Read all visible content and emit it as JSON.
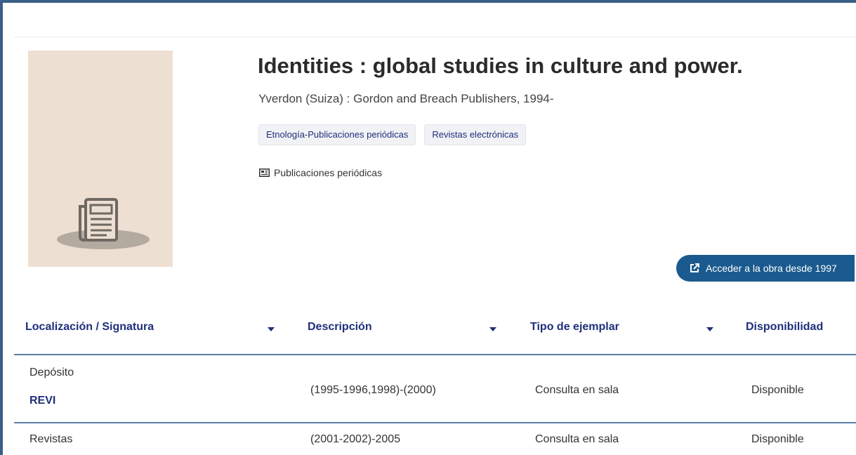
{
  "record": {
    "title": "Identities : global studies in culture and power.",
    "publisher": "Yverdon (Suiza) : Gordon and Breach Publishers, 1994-",
    "tags": [
      "Etnología-Publicaciones periódicas",
      "Revistas electrónicas"
    ],
    "type_label": "Publicaciones periódicas",
    "type_icon": "newspaper-icon",
    "cover_icon": "newspaper-icon",
    "access_button": "Acceder a la obra desde 1997",
    "access_icon": "external-link-icon"
  },
  "table": {
    "columns": [
      {
        "label": "Localización / Signatura",
        "sortable": true
      },
      {
        "label": "Descripción",
        "sortable": true
      },
      {
        "label": "Tipo de ejemplar",
        "sortable": true
      },
      {
        "label": "Disponibilidad",
        "sortable": false
      }
    ],
    "rows": [
      {
        "location": "Depósito",
        "signature": "REVI",
        "description": "(1995-1996,1998)-(2000)",
        "type": "Consulta en sala",
        "availability": "Disponible"
      },
      {
        "location": "Revistas",
        "signature": "",
        "description": "(2001-2002)-2005",
        "type": "Consulta en sala",
        "availability": "Disponible"
      }
    ]
  },
  "colors": {
    "link": "#1f2f7a",
    "button": "#1b5a8e",
    "cover_bg": "#eddfd2",
    "frame": "#3b5f86"
  }
}
